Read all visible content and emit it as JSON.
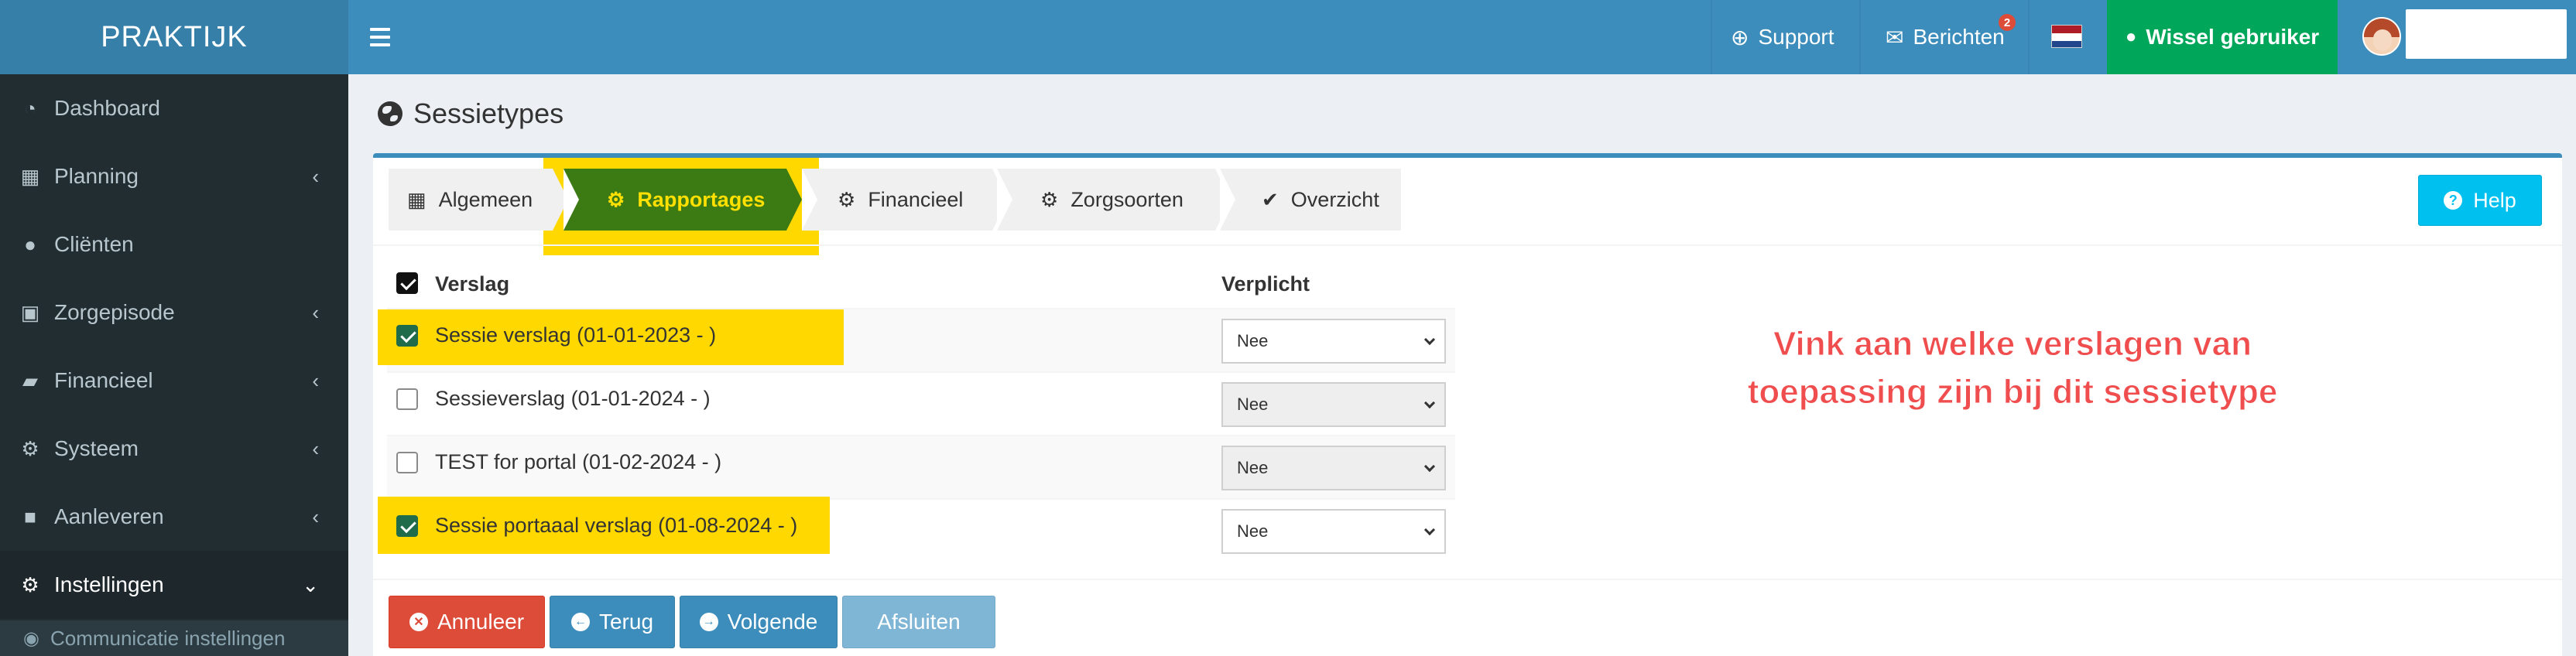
{
  "header": {
    "logo": "PRAKTIJK",
    "support": "Support",
    "berichten": "Berichten",
    "berichten_badge": "2",
    "wissel": "Wissel gebruiker"
  },
  "sidebar": {
    "items": [
      {
        "label": "Dashboard",
        "icon": "dashboard-icon",
        "chevron": ""
      },
      {
        "label": "Planning",
        "icon": "calendar-icon",
        "chevron": "‹"
      },
      {
        "label": "Cliënten",
        "icon": "user-icon",
        "chevron": ""
      },
      {
        "label": "Zorgepisode",
        "icon": "briefcase-icon",
        "chevron": "‹"
      },
      {
        "label": "Financieel",
        "icon": "book-icon",
        "chevron": "‹"
      },
      {
        "label": "Systeem",
        "icon": "cogs-icon",
        "chevron": "‹"
      },
      {
        "label": "Aanleveren",
        "icon": "truck-icon",
        "chevron": "‹"
      },
      {
        "label": "Instellingen",
        "icon": "gear-icon",
        "chevron": "⌄"
      }
    ],
    "sub_item": "Communicatie instellingen"
  },
  "page": {
    "title": "Sessietypes"
  },
  "steps": [
    {
      "label": "Algemeen",
      "icon": "table-icon"
    },
    {
      "label": "Rapportages",
      "icon": "gear-icon"
    },
    {
      "label": "Financieel",
      "icon": "gear-icon"
    },
    {
      "label": "Zorgsoorten",
      "icon": "gear-icon"
    },
    {
      "label": "Overzicht",
      "icon": "check-icon"
    }
  ],
  "help_label": "Help",
  "table": {
    "col_verslag": "Verslag",
    "col_verplicht": "Verplicht",
    "rows": [
      {
        "label": "Sessie verslag (01-01-2023 - )",
        "checked": true,
        "verplicht": "Nee",
        "enabled": true
      },
      {
        "label": "Sessieverslag (01-01-2024 - )",
        "checked": false,
        "verplicht": "Nee",
        "enabled": false
      },
      {
        "label": "TEST for portal (01-02-2024 - )",
        "checked": false,
        "verplicht": "Nee",
        "enabled": false
      },
      {
        "label": "Sessie portaaal verslag (01-08-2024 - )",
        "checked": true,
        "verplicht": "Nee",
        "enabled": true
      }
    ]
  },
  "annotation": {
    "line1": "Vink aan welke verslagen van",
    "line2": "toepassing zijn bij dit sessietype"
  },
  "buttons": {
    "annuleer": "Annuleer",
    "terug": "Terug",
    "volgende": "Volgende",
    "afsluiten": "Afsluiten"
  },
  "colors": {
    "header": "#3c8dbc",
    "sidebar": "#222d32",
    "highlight": "#ffd800",
    "active_step": "#3c7a14",
    "annotation": "#f04e4e"
  }
}
